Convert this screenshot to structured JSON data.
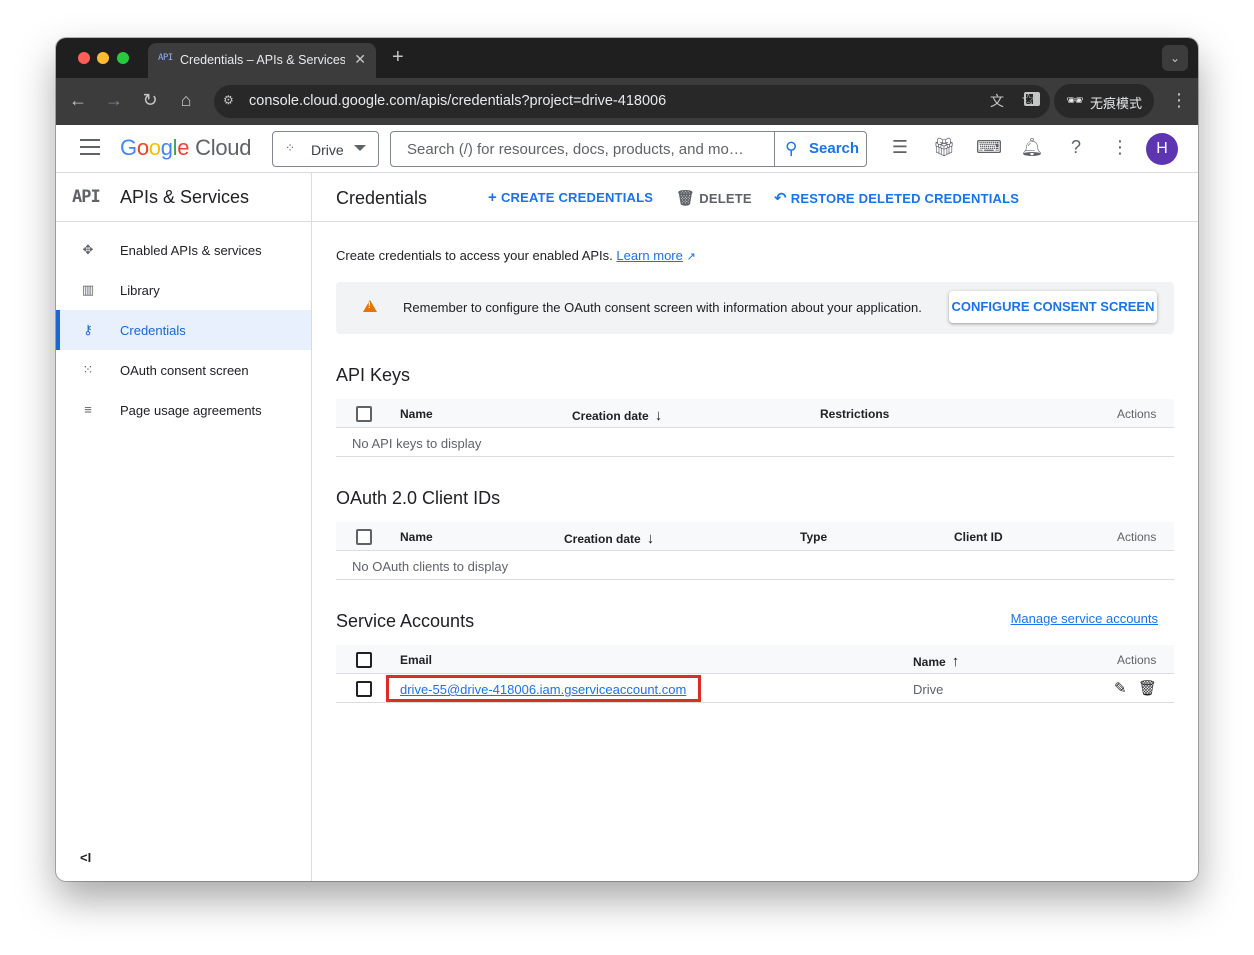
{
  "browser": {
    "tab_title": "Credentials – APIs & Services",
    "tab_favicon": "API",
    "url": "console.cloud.google.com/apis/credentials?project=drive-418006",
    "incognito_label": "无痕模式"
  },
  "header": {
    "logo_google": [
      "G",
      "o",
      "o",
      "g",
      "l",
      "e"
    ],
    "logo_cloud": "Cloud",
    "project_name": "Drive",
    "search_placeholder": "Search (/) for resources, docs, products, and mo…",
    "search_button": "Search",
    "avatar_letter": "H"
  },
  "sidebar": {
    "api_badge": "API",
    "title": "APIs & Services",
    "items": [
      {
        "label": "Enabled APIs & services",
        "icon": "diamond-nodes-icon"
      },
      {
        "label": "Library",
        "icon": "library-icon"
      },
      {
        "label": "Credentials",
        "icon": "key-icon",
        "active": true
      },
      {
        "label": "OAuth consent screen",
        "icon": "dots-grid-icon"
      },
      {
        "label": "Page usage agreements",
        "icon": "settings-list-icon"
      }
    ],
    "collapse_label": "<I"
  },
  "main": {
    "page_title": "Credentials",
    "actions": {
      "create": "CREATE CREDENTIALS",
      "delete": "DELETE",
      "restore": "RESTORE DELETED CREDENTIALS"
    },
    "intro_text": "Create credentials to access your enabled APIs.",
    "learn_more": "Learn more",
    "banner_text": "Remember to configure the OAuth consent screen with information about your application.",
    "banner_button": "CONFIGURE CONSENT SCREEN",
    "api_keys": {
      "title": "API Keys",
      "columns": [
        "Name",
        "Creation date",
        "Restrictions",
        "Actions"
      ],
      "empty": "No API keys to display"
    },
    "oauth": {
      "title": "OAuth 2.0 Client IDs",
      "columns": [
        "Name",
        "Creation date",
        "Type",
        "Client ID",
        "Actions"
      ],
      "empty": "No OAuth clients to display"
    },
    "service_accounts": {
      "title": "Service Accounts",
      "manage_link": "Manage service accounts",
      "columns": [
        "Email",
        "Name",
        "Actions"
      ],
      "rows": [
        {
          "email": "drive-55@drive-418006.iam.gserviceaccount.com",
          "name": "Drive"
        }
      ]
    }
  },
  "colors": {
    "accent": "#1a73e8",
    "highlight_box": "#d93025",
    "warning": "#e37400",
    "avatar": "#5e35b1"
  }
}
